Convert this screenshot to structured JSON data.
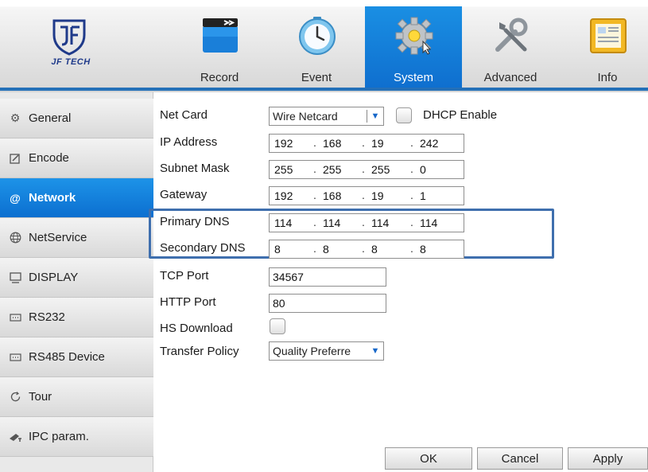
{
  "app": {
    "brand": "JF TECH"
  },
  "tabs": [
    {
      "label": "Record",
      "icon": "clapper-icon"
    },
    {
      "label": "Event",
      "icon": "clock-icon"
    },
    {
      "label": "System",
      "icon": "gear-icon",
      "active": true
    },
    {
      "label": "Advanced",
      "icon": "tools-icon"
    },
    {
      "label": "Info",
      "icon": "info-document-icon"
    }
  ],
  "sidebar": {
    "items": [
      {
        "label": "General",
        "icon": "gear-icon"
      },
      {
        "label": "Encode",
        "icon": "edit-icon"
      },
      {
        "label": "Network",
        "icon": "at-icon",
        "active": true
      },
      {
        "label": "NetService",
        "icon": "globe-icon"
      },
      {
        "label": "DISPLAY",
        "icon": "monitor-icon"
      },
      {
        "label": "RS232",
        "icon": "serial-icon"
      },
      {
        "label": "RS485 Device",
        "icon": "serial-icon"
      },
      {
        "label": "Tour",
        "icon": "tour-icon"
      },
      {
        "label": "IPC param.",
        "icon": "camera-icon"
      }
    ]
  },
  "network": {
    "net_card_label": "Net Card",
    "net_card_value": "Wire Netcard",
    "dhcp_label": "DHCP Enable",
    "dhcp_checked": false,
    "ip_label": "IP Address",
    "ip": [
      "192",
      "168",
      "19",
      "242"
    ],
    "subnet_label": "Subnet Mask",
    "subnet": [
      "255",
      "255",
      "255",
      "0"
    ],
    "gateway_label": "Gateway",
    "gateway": [
      "192",
      "168",
      "19",
      "1"
    ],
    "primary_dns_label": "Primary DNS",
    "primary_dns": [
      "114",
      "114",
      "114",
      "114"
    ],
    "secondary_dns_label": "Secondary DNS",
    "secondary_dns": [
      "8",
      "8",
      "8",
      "8"
    ],
    "tcp_port_label": "TCP Port",
    "tcp_port": "34567",
    "http_port_label": "HTTP Port",
    "http_port": "80",
    "hs_download_label": "HS Download",
    "hs_download_checked": false,
    "transfer_policy_label": "Transfer Policy",
    "transfer_policy_value": "Quality Preferre"
  },
  "buttons": {
    "ok": "OK",
    "cancel": "Cancel",
    "apply": "Apply"
  },
  "colors": {
    "accent": "#1a8fe3",
    "highlight_box": "#3f6fae",
    "select_arrow": "#1767c9"
  }
}
